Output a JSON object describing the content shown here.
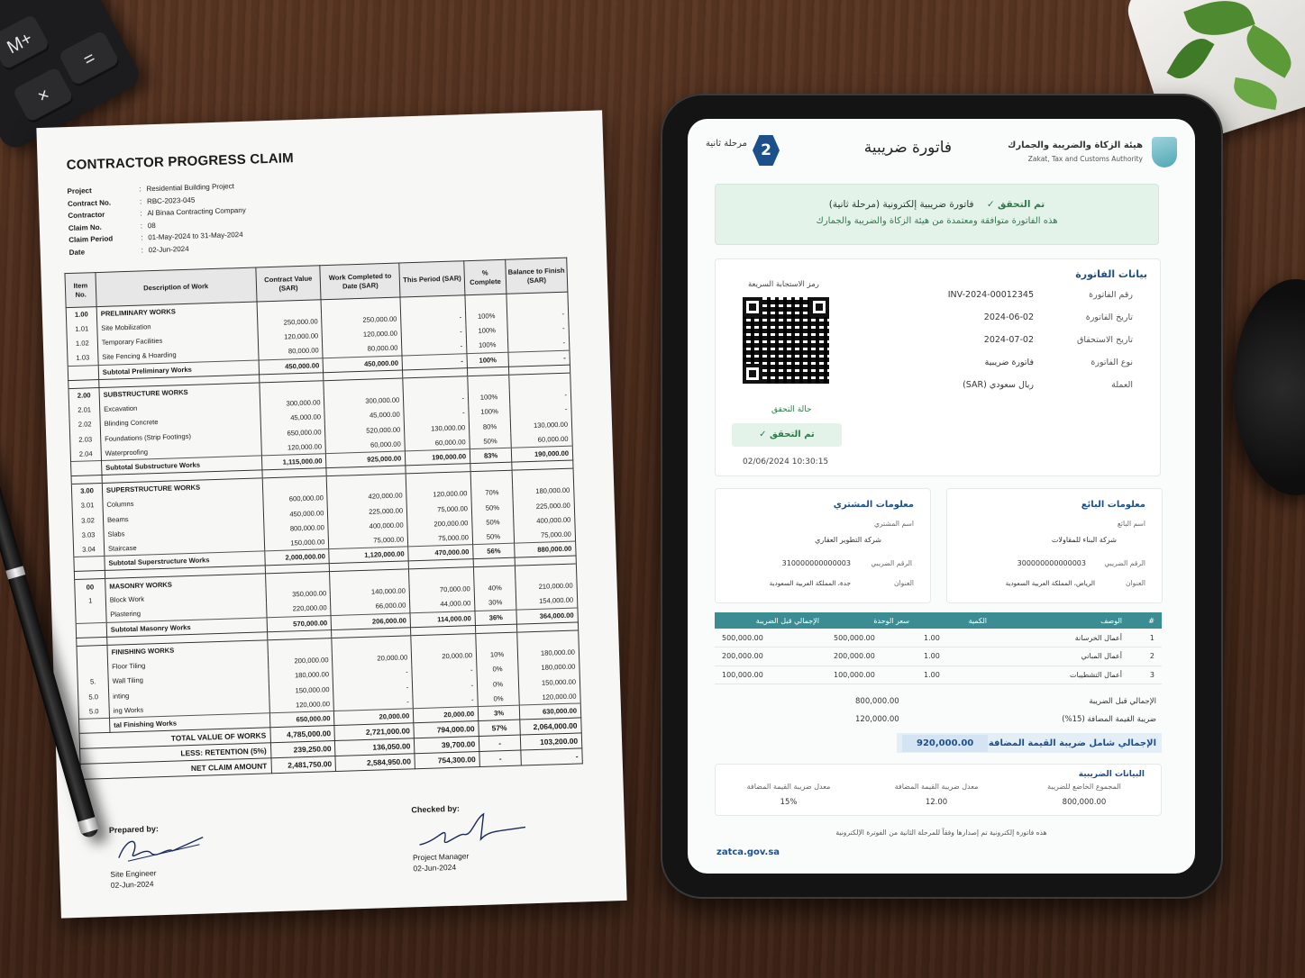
{
  "props": {
    "calc_key_mplus": "M+",
    "calc_key_equal": "=",
    "calc_key_times": "×"
  },
  "claim": {
    "title": "CONTRACTOR PROGRESS CLAIM",
    "meta": [
      {
        "label": "Project",
        "value": "Residential Building Project"
      },
      {
        "label": "Contract No.",
        "value": "RBC-2023-045"
      },
      {
        "label": "Contractor",
        "value": "Al Binaa Contracting Company"
      },
      {
        "label": "Claim No.",
        "value": "08"
      },
      {
        "label": "Claim Period",
        "value": "01-May-2024 to 31-May-2024"
      },
      {
        "label": "Date",
        "value": "02-Jun-2024"
      }
    ],
    "headers": {
      "item": "Item No.",
      "desc": "Description of Work",
      "cv": "Contract Value (SAR)",
      "wc": "Work Completed to Date (SAR)",
      "tp": "This Period (SAR)",
      "pc": "% Complete",
      "bal": "Balance to Finish (SAR)"
    },
    "rows": [
      {
        "t": "sec",
        "item": "1.00",
        "desc": "PRELIMINARY WORKS"
      },
      {
        "t": "row",
        "item": "1.01",
        "desc": "Site Mobilization",
        "cv": "250,000.00",
        "wc": "250,000.00",
        "tp": "-",
        "pc": "100%",
        "bal": "-"
      },
      {
        "t": "row",
        "item": "1.02",
        "desc": "Temporary Facilities",
        "cv": "120,000.00",
        "wc": "120,000.00",
        "tp": "-",
        "pc": "100%",
        "bal": "-"
      },
      {
        "t": "row",
        "item": "1.03",
        "desc": "Site Fencing & Hoarding",
        "cv": "80,000.00",
        "wc": "80,000.00",
        "tp": "-",
        "pc": "100%",
        "bal": "-"
      },
      {
        "t": "sub",
        "item": "",
        "desc": "Subtotal Preliminary Works",
        "cv": "450,000.00",
        "wc": "450,000.00",
        "tp": "-",
        "pc": "100%",
        "bal": "-"
      },
      {
        "t": "spacer"
      },
      {
        "t": "sec",
        "item": "2.00",
        "desc": "SUBSTRUCTURE WORKS"
      },
      {
        "t": "row",
        "item": "2.01",
        "desc": "Excavation",
        "cv": "300,000.00",
        "wc": "300,000.00",
        "tp": "-",
        "pc": "100%",
        "bal": "-"
      },
      {
        "t": "row",
        "item": "2.02",
        "desc": "Blinding Concrete",
        "cv": "45,000.00",
        "wc": "45,000.00",
        "tp": "-",
        "pc": "100%",
        "bal": "-"
      },
      {
        "t": "row",
        "item": "2.03",
        "desc": "Foundations (Strip Footings)",
        "cv": "650,000.00",
        "wc": "520,000.00",
        "tp": "130,000.00",
        "pc": "80%",
        "bal": "130,000.00"
      },
      {
        "t": "row",
        "item": "2.04",
        "desc": "Waterproofing",
        "cv": "120,000.00",
        "wc": "60,000.00",
        "tp": "60,000.00",
        "pc": "50%",
        "bal": "60,000.00"
      },
      {
        "t": "sub",
        "item": "",
        "desc": "Subtotal Substructure Works",
        "cv": "1,115,000.00",
        "wc": "925,000.00",
        "tp": "190,000.00",
        "pc": "83%",
        "bal": "190,000.00"
      },
      {
        "t": "spacer"
      },
      {
        "t": "sec",
        "item": "3.00",
        "desc": "SUPERSTRUCTURE WORKS"
      },
      {
        "t": "row",
        "item": "3.01",
        "desc": "Columns",
        "cv": "600,000.00",
        "wc": "420,000.00",
        "tp": "120,000.00",
        "pc": "70%",
        "bal": "180,000.00"
      },
      {
        "t": "row",
        "item": "3.02",
        "desc": "Beams",
        "cv": "450,000.00",
        "wc": "225,000.00",
        "tp": "75,000.00",
        "pc": "50%",
        "bal": "225,000.00"
      },
      {
        "t": "row",
        "item": "3.03",
        "desc": "Slabs",
        "cv": "800,000.00",
        "wc": "400,000.00",
        "tp": "200,000.00",
        "pc": "50%",
        "bal": "400,000.00"
      },
      {
        "t": "row",
        "item": "3.04",
        "desc": "Staircase",
        "cv": "150,000.00",
        "wc": "75,000.00",
        "tp": "75,000.00",
        "pc": "50%",
        "bal": "75,000.00"
      },
      {
        "t": "sub",
        "item": "",
        "desc": "Subtotal Superstructure Works",
        "cv": "2,000,000.00",
        "wc": "1,120,000.00",
        "tp": "470,000.00",
        "pc": "56%",
        "bal": "880,000.00"
      },
      {
        "t": "spacer"
      },
      {
        "t": "sec",
        "item": "00",
        "desc": "MASONRY WORKS"
      },
      {
        "t": "row",
        "item": "1",
        "desc": "Block Work",
        "cv": "350,000.00",
        "wc": "140,000.00",
        "tp": "70,000.00",
        "pc": "40%",
        "bal": "210,000.00"
      },
      {
        "t": "row",
        "item": "",
        "desc": "Plastering",
        "cv": "220,000.00",
        "wc": "66,000.00",
        "tp": "44,000.00",
        "pc": "30%",
        "bal": "154,000.00"
      },
      {
        "t": "sub",
        "item": "",
        "desc": "Subtotal Masonry Works",
        "cv": "570,000.00",
        "wc": "206,000.00",
        "tp": "114,000.00",
        "pc": "36%",
        "bal": "364,000.00"
      },
      {
        "t": "spacer"
      },
      {
        "t": "sec",
        "item": "",
        "desc": "FINISHING WORKS"
      },
      {
        "t": "row",
        "item": "",
        "desc": "Floor Tiling",
        "cv": "200,000.00",
        "wc": "20,000.00",
        "tp": "20,000.00",
        "pc": "10%",
        "bal": "180,000.00"
      },
      {
        "t": "row",
        "item": "5.",
        "desc": "Wall Tiling",
        "cv": "180,000.00",
        "wc": "-",
        "tp": "-",
        "pc": "0%",
        "bal": "180,000.00"
      },
      {
        "t": "row",
        "item": "5.0",
        "desc": "inting",
        "cv": "150,000.00",
        "wc": "-",
        "tp": "-",
        "pc": "0%",
        "bal": "150,000.00"
      },
      {
        "t": "row",
        "item": "5.0",
        "desc": "ing Works",
        "cv": "120,000.00",
        "wc": "-",
        "tp": "-",
        "pc": "0%",
        "bal": "120,000.00"
      },
      {
        "t": "sub",
        "item": "",
        "desc": "tal Finishing Works",
        "cv": "650,000.00",
        "wc": "20,000.00",
        "tp": "20,000.00",
        "pc": "3%",
        "bal": "630,000.00"
      }
    ],
    "totals": [
      {
        "label": "TOTAL VALUE OF WORKS",
        "cv": "4,785,000.00",
        "wc": "2,721,000.00",
        "tp": "794,000.00",
        "pc": "57%",
        "bal": "2,064,000.00"
      },
      {
        "label": "LESS: RETENTION (5%)",
        "cv": "239,250.00",
        "wc": "136,050.00",
        "tp": "39,700.00",
        "pc": "-",
        "bal": "103,200.00"
      },
      {
        "label": "NET CLAIM AMOUNT",
        "cv": "2,481,750.00",
        "wc": "2,584,950.00",
        "tp": "754,300.00",
        "pc": "-",
        "bal": "-"
      }
    ],
    "prepared": {
      "head": "Prepared by:",
      "role": "Site Engineer",
      "date": "02-Jun-2024"
    },
    "checked": {
      "head": "Checked by:",
      "role": "Project Manager",
      "date": "02-Jun-2024"
    }
  },
  "invoice": {
    "authority_ar": "هيئة الزكاة والضريبة والجمارك",
    "authority_en": "Zakat, Tax and Customs Authority",
    "title": "فاتورة ضريبية",
    "phase_num": "2",
    "phase_txt": "مرحلة ثانية",
    "banner_ok": "تم التحقق",
    "banner_line1": "فاتورة ضريبية إلكترونية (مرحلة ثانية)",
    "banner_line2": "هذه الفاتورة متوافقة ومعتمدة من هيئة الزكاة والضريبة والجمارك",
    "details_title": "بيانات الفاتورة",
    "details": [
      {
        "label": "رقم الفاتورة",
        "value": "INV-2024-00012345"
      },
      {
        "label": "تاريخ الفاتورة",
        "value": "2024-06-02"
      },
      {
        "label": "تاريخ الاستحقاق",
        "value": "2024-07-02"
      },
      {
        "label": "نوع الفاتورة",
        "value": "فاتورة ضريبية"
      },
      {
        "label": "العملة",
        "value": "ريال سعودي (SAR)"
      }
    ],
    "qr_label": "رمز الاستجابة السريعة",
    "vstatus_label": "حالة التحقق",
    "vstatus_pill": "تم التحقق",
    "vstatus_time": "02/06/2024 10:30:15",
    "seller": {
      "title": "معلومات البائع",
      "name_label": "اسم البائع",
      "name": "شركة البناء للمقاولات",
      "vat_label": "الرقم الضريبي",
      "vat": "300000000000003",
      "addr_label": "العنوان",
      "addr": "الرياض، المملكة العربية السعودية"
    },
    "buyer": {
      "title": "معلومات المشتري",
      "name_label": "اسم المشتري",
      "name": "شركة التطوير العقاري",
      "vat_label": "الرقم الضريبي",
      "vat": "310000000000003",
      "addr_label": "العنوان",
      "addr": "جدة، المملكة العربية السعودية"
    },
    "items_headers": {
      "num": "#",
      "desc": "الوصف",
      "qty": "الكمية",
      "unit": "سعر الوحدة",
      "total": "الإجمالي قبل الضريبة"
    },
    "items": [
      {
        "num": "1",
        "desc": "أعمال الخرسانة",
        "qty": "1.00",
        "unit": "500,000.00",
        "total": "500,000.00"
      },
      {
        "num": "2",
        "desc": "أعمال المباني",
        "qty": "1.00",
        "unit": "200,000.00",
        "total": "200,000.00"
      },
      {
        "num": "3",
        "desc": "أعمال التشطيبات",
        "qty": "1.00",
        "unit": "100,000.00",
        "total": "100,000.00"
      }
    ],
    "subtotal_label": "الإجمالي قبل الضريبة",
    "subtotal": "800,000.00",
    "vat_label": "ضريبة القيمة المضافة (15%)",
    "vat": "120,000.00",
    "grand_label": "الإجمالي شامل ضريبة القيمة المضافة",
    "grand": "920,000.00",
    "tax_title": "البيانات الضريبية",
    "tax": [
      {
        "label": "المجموع الخاضع للضريبة",
        "value": "800,000.00"
      },
      {
        "label": "معدل ضريبة القيمة المضافة",
        "value": "12.00"
      },
      {
        "label": "معدل ضريبة القيمة المضافة",
        "value": "15%"
      }
    ],
    "footnote": "هذه فاتورة إلكترونية تم إصدارها وفقاً للمرحلة الثانية من الفوترة الإلكترونية",
    "site": "zatca.gov.sa"
  }
}
